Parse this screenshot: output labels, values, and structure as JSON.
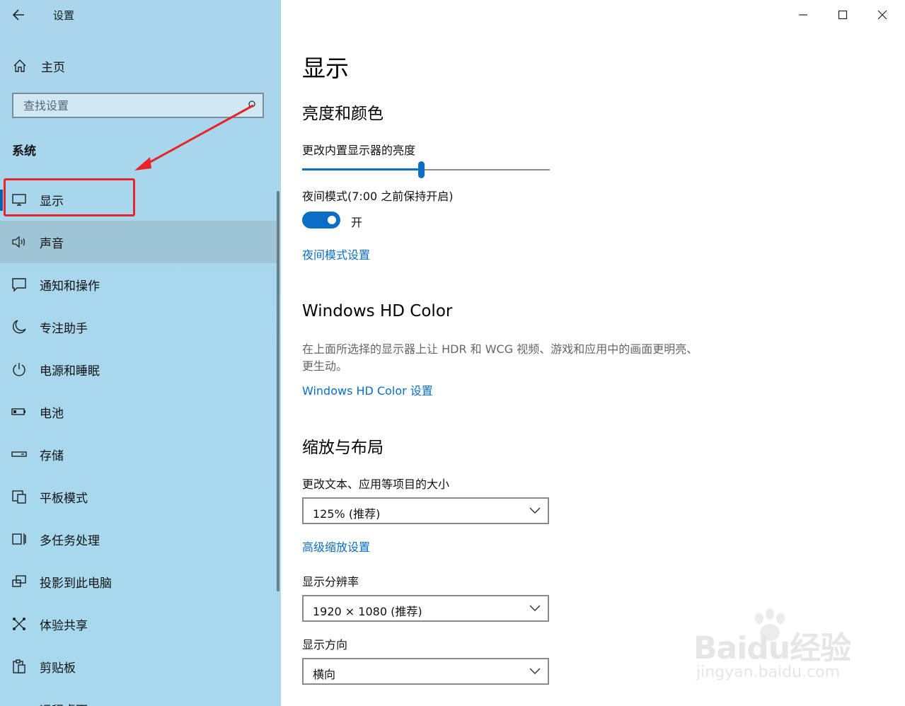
{
  "window": {
    "title": "设置"
  },
  "sidebar": {
    "home_label": "主页",
    "search_placeholder": "查找设置",
    "section_title": "系统",
    "items": [
      {
        "label": "显示",
        "icon": "monitor-icon",
        "state": "selected"
      },
      {
        "label": "声音",
        "icon": "speaker-icon",
        "state": "hover"
      },
      {
        "label": "通知和操作",
        "icon": "notification-icon"
      },
      {
        "label": "专注助手",
        "icon": "moon-icon"
      },
      {
        "label": "电源和睡眠",
        "icon": "power-icon"
      },
      {
        "label": "电池",
        "icon": "battery-icon"
      },
      {
        "label": "存储",
        "icon": "storage-icon"
      },
      {
        "label": "平板模式",
        "icon": "tablet-mode-icon"
      },
      {
        "label": "多任务处理",
        "icon": "multitasking-icon"
      },
      {
        "label": "投影到此电脑",
        "icon": "project-icon"
      },
      {
        "label": "体验共享",
        "icon": "shared-experiences-icon"
      },
      {
        "label": "剪贴板",
        "icon": "clipboard-icon"
      },
      {
        "label": "远程桌面",
        "icon": "remote-desktop-icon"
      }
    ]
  },
  "main": {
    "page_title": "显示",
    "brightness": {
      "heading": "亮度和颜色",
      "slider_label": "更改内置显示器的亮度",
      "slider_value": 0.48
    },
    "night_light": {
      "label": "夜间模式(7:00 之前保持开启)",
      "toggle_state": "开",
      "toggle_on": true,
      "settings_link": "夜间模式设置"
    },
    "hd_color": {
      "heading": "Windows HD Color",
      "description": "在上面所选择的显示器上让 HDR 和 WCG 视频、游戏和应用中的画面更明亮、更生动。",
      "link": "Windows HD Color 设置"
    },
    "scale_layout": {
      "heading": "缩放与布局",
      "scale_label": "更改文本、应用等项目的大小",
      "scale_value": "125% (推荐)",
      "advanced_link": "高级缩放设置",
      "resolution_label": "显示分辨率",
      "resolution_value": "1920 × 1080 (推荐)",
      "orientation_label": "显示方向",
      "orientation_value": "横向"
    }
  },
  "watermark": {
    "logo": "Baidu经验",
    "sub": "jingyan.baidu.com"
  },
  "colors": {
    "accent": "#0a6fc4",
    "sidebar_bg": "#a9d6ed",
    "highlight_box": "#e8242a"
  }
}
